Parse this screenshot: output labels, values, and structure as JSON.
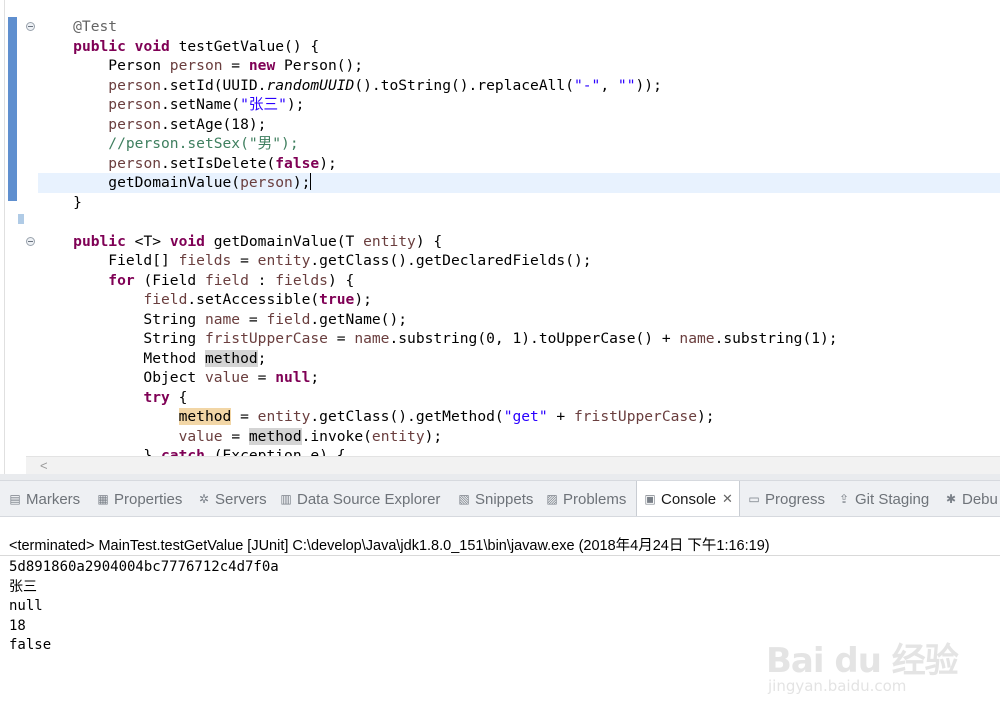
{
  "editor": {
    "lines": [
      [
        [
          "ann",
          "    @Test"
        ]
      ],
      [
        [
          "",
          "    "
        ],
        [
          "kw",
          "public void"
        ],
        [
          "",
          " testGetValue() {"
        ]
      ],
      [
        [
          "",
          "        Person "
        ],
        [
          "var",
          "person"
        ],
        [
          "",
          " = "
        ],
        [
          "kw",
          "new"
        ],
        [
          "",
          " Person();"
        ]
      ],
      [
        [
          "",
          "        "
        ],
        [
          "var",
          "person"
        ],
        [
          "",
          ".setId(UUID."
        ],
        [
          "ital",
          "randomUUID"
        ],
        [
          "",
          "().toString().replaceAll("
        ],
        [
          "str",
          "\"-\""
        ],
        [
          "",
          ", "
        ],
        [
          "str",
          "\"\""
        ],
        [
          "",
          "));"
        ]
      ],
      [
        [
          "",
          "        "
        ],
        [
          "var",
          "person"
        ],
        [
          "",
          ".setName("
        ],
        [
          "str",
          "\"张三\""
        ],
        [
          "",
          ");"
        ]
      ],
      [
        [
          "",
          "        "
        ],
        [
          "var",
          "person"
        ],
        [
          "",
          ".setAge(18);"
        ]
      ],
      [
        [
          "",
          "        "
        ],
        [
          "cmt",
          "//person.setSex(\"男\");"
        ]
      ],
      [
        [
          "",
          "        "
        ],
        [
          "var",
          "person"
        ],
        [
          "",
          ".setIsDelete("
        ],
        [
          "kw",
          "false"
        ],
        [
          "",
          ");"
        ]
      ],
      [
        [
          "",
          "        getDomainValue("
        ],
        [
          "var",
          "person"
        ],
        [
          "",
          ");"
        ],
        [
          "caret",
          ""
        ]
      ],
      [
        [
          "",
          "    }"
        ]
      ],
      [
        [
          "",
          ""
        ]
      ],
      [
        [
          "",
          "    "
        ],
        [
          "kw",
          "public"
        ],
        [
          "",
          " <T> "
        ],
        [
          "kw",
          "void"
        ],
        [
          "",
          " getDomainValue(T "
        ],
        [
          "var",
          "entity"
        ],
        [
          "",
          ") {"
        ]
      ],
      [
        [
          "",
          "        Field[] "
        ],
        [
          "var",
          "fields"
        ],
        [
          "",
          " = "
        ],
        [
          "var",
          "entity"
        ],
        [
          "",
          ".getClass().getDeclaredFields();"
        ]
      ],
      [
        [
          "",
          "        "
        ],
        [
          "kw",
          "for"
        ],
        [
          "",
          " (Field "
        ],
        [
          "var",
          "field"
        ],
        [
          "",
          " : "
        ],
        [
          "var",
          "fields"
        ],
        [
          "",
          ") {"
        ]
      ],
      [
        [
          "",
          "            "
        ],
        [
          "var",
          "field"
        ],
        [
          "",
          ".setAccessible("
        ],
        [
          "kw",
          "true"
        ],
        [
          "",
          ");"
        ]
      ],
      [
        [
          "",
          "            String "
        ],
        [
          "var",
          "name"
        ],
        [
          "",
          " = "
        ],
        [
          "var",
          "field"
        ],
        [
          "",
          ".getName();"
        ]
      ],
      [
        [
          "",
          "            String "
        ],
        [
          "var",
          "fristUpperCase"
        ],
        [
          "",
          " = "
        ],
        [
          "var",
          "name"
        ],
        [
          "",
          ".substring(0, 1).toUpperCase() + "
        ],
        [
          "var",
          "name"
        ],
        [
          "",
          ".substring(1);"
        ]
      ],
      [
        [
          "",
          "            Method "
        ],
        [
          "occ",
          "method"
        ],
        [
          "",
          ";"
        ]
      ],
      [
        [
          "",
          "            Object "
        ],
        [
          "var",
          "value"
        ],
        [
          "",
          " = "
        ],
        [
          "kw",
          "null"
        ],
        [
          "",
          ";"
        ]
      ],
      [
        [
          "",
          "            "
        ],
        [
          "kw",
          "try"
        ],
        [
          "",
          " {"
        ]
      ],
      [
        [
          "",
          "                "
        ],
        [
          "occw",
          "method"
        ],
        [
          "",
          " = "
        ],
        [
          "var",
          "entity"
        ],
        [
          "",
          ".getClass().getMethod("
        ],
        [
          "str",
          "\"get\""
        ],
        [
          "",
          " + "
        ],
        [
          "var",
          "fristUpperCase"
        ],
        [
          "",
          ");"
        ]
      ],
      [
        [
          "",
          "                "
        ],
        [
          "var",
          "value"
        ],
        [
          "",
          " = "
        ],
        [
          "occ",
          "method"
        ],
        [
          "",
          ".invoke("
        ],
        [
          "var",
          "entity"
        ],
        [
          "",
          ");"
        ]
      ],
      [
        [
          "",
          "            } "
        ],
        [
          "kw",
          "catch"
        ],
        [
          "",
          " (Exception e) {"
        ]
      ]
    ],
    "scroll_left_glyph": "<"
  },
  "tabs": [
    {
      "label": "Markers",
      "icon": "markers-icon",
      "glyph": "▤"
    },
    {
      "label": "Properties",
      "icon": "properties-icon",
      "glyph": "▦"
    },
    {
      "label": "Servers",
      "icon": "servers-icon",
      "glyph": "✲"
    },
    {
      "label": "Data Source Explorer",
      "icon": "data-source-icon",
      "glyph": "▥"
    },
    {
      "label": "Snippets",
      "icon": "snippets-icon",
      "glyph": "▧"
    },
    {
      "label": "Problems",
      "icon": "problems-icon",
      "glyph": "▨"
    },
    {
      "label": "Console",
      "icon": "console-icon",
      "glyph": "▣",
      "active": true,
      "close": "✕"
    },
    {
      "label": "Progress",
      "icon": "progress-icon",
      "glyph": "▭"
    },
    {
      "label": "Git Staging",
      "icon": "git-staging-icon",
      "glyph": "⇪"
    },
    {
      "label": "Debu",
      "icon": "debug-icon",
      "glyph": "✱"
    }
  ],
  "console": {
    "header": "<terminated> MainTest.testGetValue [JUnit] C:\\develop\\Java\\jdk1.8.0_151\\bin\\javaw.exe (2018年4月24日 下午1:16:19)",
    "output": [
      "5d891860a2904004bc7776712c4d7f0a",
      "张三",
      "null",
      "18",
      "false"
    ]
  },
  "watermark": {
    "brand": "Bai du 经验",
    "url": "jingyan.baidu.com"
  }
}
